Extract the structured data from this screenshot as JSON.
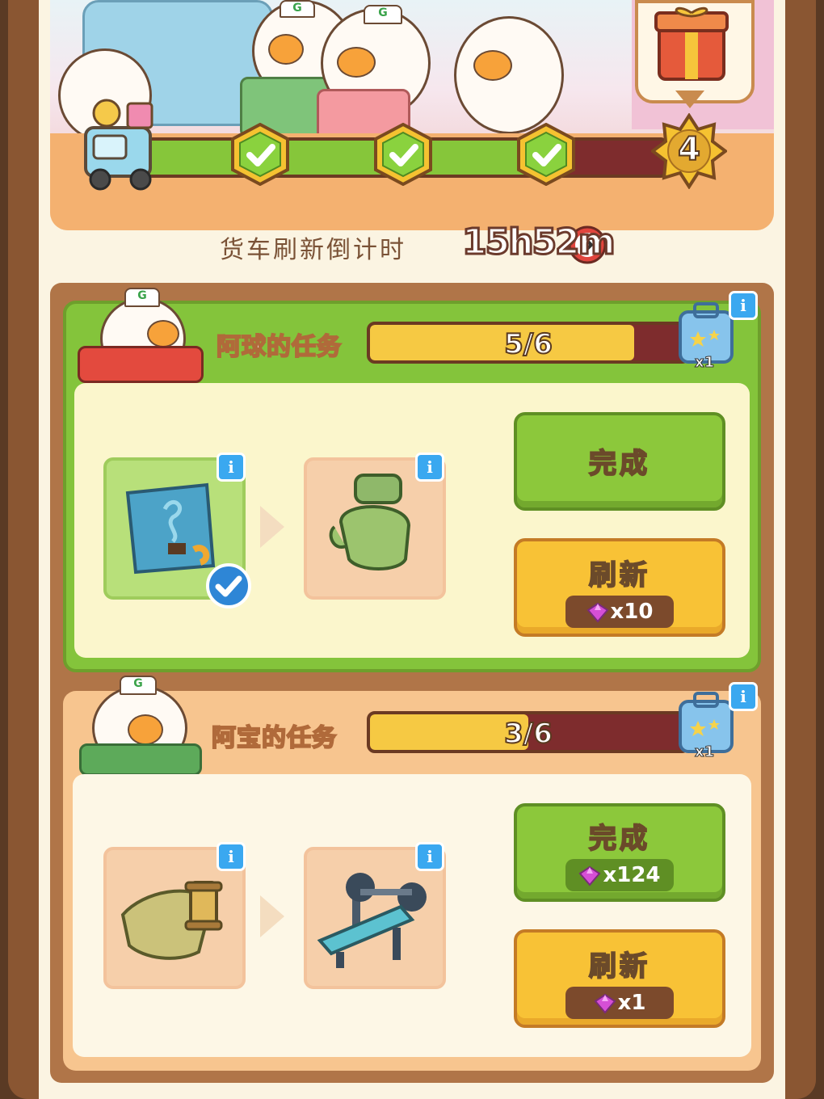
{
  "banner": {
    "milestone_number": "4",
    "milestones_completed": 3,
    "milestones_total": 4
  },
  "timer": {
    "label": "货车刷新倒计时",
    "value": "15h52m"
  },
  "tasks": [
    {
      "title": "阿球的任务",
      "progress_text": "5/6",
      "progress_fraction": 0.8333,
      "reward_count": "x1",
      "items": [
        {
          "icon": "blueprint-icon",
          "done": true
        },
        {
          "icon": "glove-icon",
          "done": false
        }
      ],
      "complete_label": "完成",
      "complete_cost": "",
      "refresh_label": "刷新",
      "refresh_cost": "x10"
    },
    {
      "title": "阿宝的任务",
      "progress_text": "3/6",
      "progress_fraction": 0.5,
      "reward_count": "x1",
      "items": [
        {
          "icon": "thread-spool-icon",
          "done": false
        },
        {
          "icon": "bench-press-icon",
          "done": false
        }
      ],
      "complete_label": "完成",
      "complete_cost": "x124",
      "refresh_label": "刷新",
      "refresh_cost": "x1"
    }
  ],
  "colors": {
    "accent_green": "#84c43b",
    "accent_yellow": "#f8c236",
    "bar_dark": "#7e2c2d",
    "gem": "#d64fd6"
  }
}
